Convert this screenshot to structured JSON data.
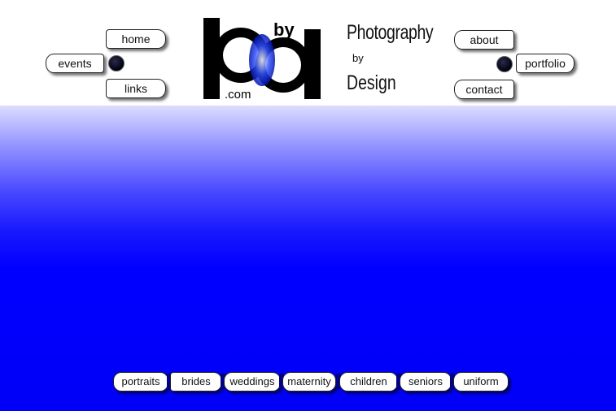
{
  "logo": {
    "text_by": "by",
    "text_dotcom": ".com",
    "brand_color": "#0a1fd8"
  },
  "brand": {
    "line1": "Photography",
    "line2": "by",
    "line3": "Design"
  },
  "left_nav": {
    "home": "home",
    "events": "events",
    "links": "links"
  },
  "right_nav": {
    "about": "about",
    "portfolio": "portfolio",
    "contact": "contact"
  },
  "bottom_nav": {
    "items": [
      "portraits",
      "brides",
      "weddings",
      "maternity",
      "children",
      "seniors",
      "uniform"
    ]
  },
  "colors": {
    "background_bottom": "#0000ff",
    "header": "#ffffff"
  }
}
